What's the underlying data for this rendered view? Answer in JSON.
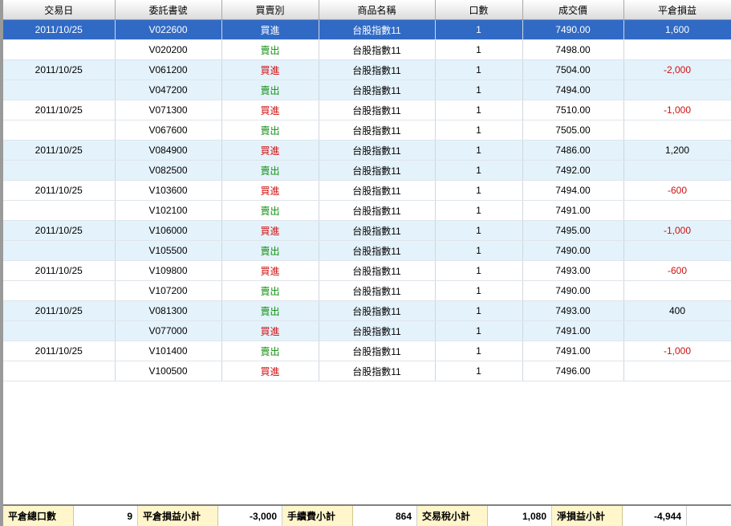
{
  "columns": [
    "交易日",
    "委託書號",
    "買賣別",
    "商品名稱",
    "口數",
    "成交價",
    "平倉損益"
  ],
  "rows": [
    {
      "date": "2011/10/25",
      "order": "V022600",
      "side": "買進",
      "side_type": "buy",
      "product": "台股指數11",
      "qty": "1",
      "price": "7490.00",
      "pl": "1,600",
      "pl_type": "pos"
    },
    {
      "date": "",
      "order": "V020200",
      "side": "賣出",
      "side_type": "sell",
      "product": "台股指數11",
      "qty": "1",
      "price": "7498.00",
      "pl": "",
      "pl_type": ""
    },
    {
      "date": "2011/10/25",
      "order": "V061200",
      "side": "買進",
      "side_type": "buy",
      "product": "台股指數11",
      "qty": "1",
      "price": "7504.00",
      "pl": "-2,000",
      "pl_type": "neg"
    },
    {
      "date": "",
      "order": "V047200",
      "side": "賣出",
      "side_type": "sell",
      "product": "台股指數11",
      "qty": "1",
      "price": "7494.00",
      "pl": "",
      "pl_type": ""
    },
    {
      "date": "2011/10/25",
      "order": "V071300",
      "side": "買進",
      "side_type": "buy",
      "product": "台股指數11",
      "qty": "1",
      "price": "7510.00",
      "pl": "-1,000",
      "pl_type": "neg"
    },
    {
      "date": "",
      "order": "V067600",
      "side": "賣出",
      "side_type": "sell",
      "product": "台股指數11",
      "qty": "1",
      "price": "7505.00",
      "pl": "",
      "pl_type": ""
    },
    {
      "date": "2011/10/25",
      "order": "V084900",
      "side": "買進",
      "side_type": "buy",
      "product": "台股指數11",
      "qty": "1",
      "price": "7486.00",
      "pl": "1,200",
      "pl_type": "pos"
    },
    {
      "date": "",
      "order": "V082500",
      "side": "賣出",
      "side_type": "sell",
      "product": "台股指數11",
      "qty": "1",
      "price": "7492.00",
      "pl": "",
      "pl_type": ""
    },
    {
      "date": "2011/10/25",
      "order": "V103600",
      "side": "買進",
      "side_type": "buy",
      "product": "台股指數11",
      "qty": "1",
      "price": "7494.00",
      "pl": "-600",
      "pl_type": "neg"
    },
    {
      "date": "",
      "order": "V102100",
      "side": "賣出",
      "side_type": "sell",
      "product": "台股指數11",
      "qty": "1",
      "price": "7491.00",
      "pl": "",
      "pl_type": ""
    },
    {
      "date": "2011/10/25",
      "order": "V106000",
      "side": "買進",
      "side_type": "buy",
      "product": "台股指數11",
      "qty": "1",
      "price": "7495.00",
      "pl": "-1,000",
      "pl_type": "neg"
    },
    {
      "date": "",
      "order": "V105500",
      "side": "賣出",
      "side_type": "sell",
      "product": "台股指數11",
      "qty": "1",
      "price": "7490.00",
      "pl": "",
      "pl_type": ""
    },
    {
      "date": "2011/10/25",
      "order": "V109800",
      "side": "買進",
      "side_type": "buy",
      "product": "台股指數11",
      "qty": "1",
      "price": "7493.00",
      "pl": "-600",
      "pl_type": "neg"
    },
    {
      "date": "",
      "order": "V107200",
      "side": "賣出",
      "side_type": "sell",
      "product": "台股指數11",
      "qty": "1",
      "price": "7490.00",
      "pl": "",
      "pl_type": ""
    },
    {
      "date": "2011/10/25",
      "order": "V081300",
      "side": "賣出",
      "side_type": "sell",
      "product": "台股指數11",
      "qty": "1",
      "price": "7493.00",
      "pl": "400",
      "pl_type": "pos"
    },
    {
      "date": "",
      "order": "V077000",
      "side": "買進",
      "side_type": "buy",
      "product": "台股指數11",
      "qty": "1",
      "price": "7491.00",
      "pl": "",
      "pl_type": ""
    },
    {
      "date": "2011/10/25",
      "order": "V101400",
      "side": "賣出",
      "side_type": "sell",
      "product": "台股指數11",
      "qty": "1",
      "price": "7491.00",
      "pl": "-1,000",
      "pl_type": "neg"
    },
    {
      "date": "",
      "order": "V100500",
      "side": "買進",
      "side_type": "buy",
      "product": "台股指數11",
      "qty": "1",
      "price": "7496.00",
      "pl": "",
      "pl_type": ""
    }
  ],
  "selected_row": 0,
  "footer": {
    "total_lots_label": "平倉總口數",
    "total_lots": "9",
    "pl_subtotal_label": "平倉損益小計",
    "pl_subtotal": "-3,000",
    "fee_subtotal_label": "手續費小計",
    "fee_subtotal": "864",
    "tax_subtotal_label": "交易稅小計",
    "tax_subtotal": "1,080",
    "net_subtotal_label": "淨損益小計",
    "net_subtotal": "-4,944"
  },
  "colors": {
    "buy": "#d01010",
    "sell": "#109010",
    "selection": "#316ac5",
    "row_alt": "#e4f2fb",
    "footer_label_bg": "#fff6cc"
  }
}
